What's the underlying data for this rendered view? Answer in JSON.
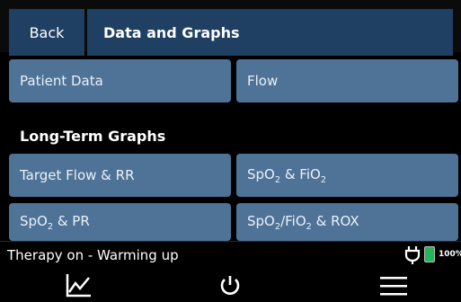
{
  "header": {
    "back_label": "Back",
    "title": "Data and Graphs"
  },
  "buttons": {
    "patient_data": "Patient Data",
    "flow": "Flow",
    "target_flow_rr": "Target Flow & RR",
    "spo2_fio2": {
      "a": "SpO",
      "b": "2",
      "c": " & FiO",
      "d": "2"
    },
    "spo2_pr": {
      "a": "SpO",
      "b": "2",
      "c": " & PR"
    },
    "spo2fio2_rox": {
      "a": "SpO",
      "b": "2",
      "c": "/FiO",
      "d": "2",
      "e": " & ROX"
    }
  },
  "section": {
    "long_term_label": "Long-Term Graphs"
  },
  "status": {
    "text": "Therapy on - Warming up",
    "battery_pct": "100%",
    "battery_color": "#26b35a"
  },
  "nav": {
    "icons": [
      "graph-icon",
      "power-icon",
      "menu-icon"
    ]
  },
  "colors": {
    "header": "#1f3f63",
    "button": "#4e7397"
  }
}
